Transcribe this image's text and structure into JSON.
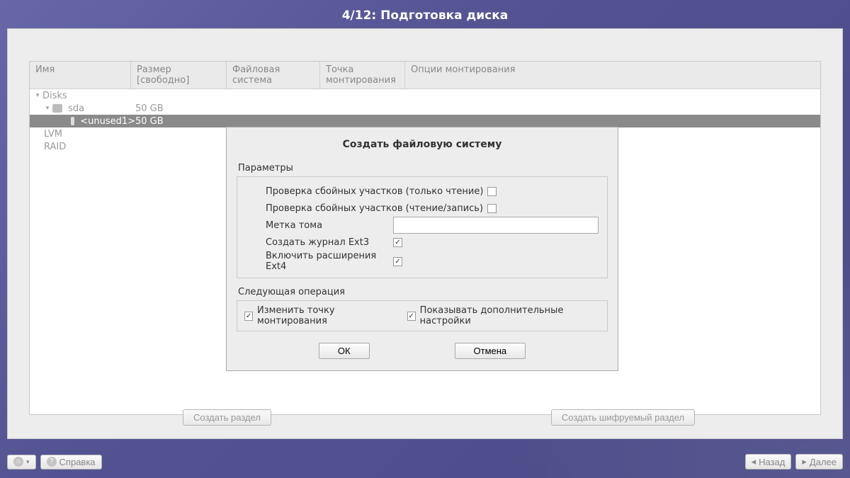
{
  "title": "4/12: Подготовка диска",
  "columns": {
    "name": "Имя",
    "size": "Размер [свободно]",
    "fs": "Файловая система",
    "mount": "Точка монтирования",
    "opts": "Опции монтирования"
  },
  "tree": {
    "disks_label": "Disks",
    "sda_label": "sda",
    "sda_size": "50 GB",
    "unused_label": "<unused1>",
    "unused_size": "50 GB",
    "lvm_label": "LVM",
    "raid_label": "RAID"
  },
  "bottom": {
    "create_partition": "Создать раздел",
    "create_encrypted": "Создать шифруемый раздел"
  },
  "footer": {
    "help": "Справка",
    "back": "Назад",
    "next": "Далее"
  },
  "dialog": {
    "title": "Создать файловую систему",
    "params_label": "Параметры",
    "check_ro": "Проверка сбойных участков (только чтение)",
    "check_rw": "Проверка сбойных участков (чтение/запись)",
    "volume_label": "Метка тома",
    "volume_value": "",
    "ext3_journal": "Создать журнал Ext3",
    "ext4_ext": "Включить расширения Ext4",
    "next_op_label": "Следующая операция",
    "change_mount": "Изменить точку монтирования",
    "show_advanced": "Показывать дополнительные настройки",
    "ok": "ОК",
    "cancel": "Отмена",
    "checks": {
      "ro": false,
      "rw": false,
      "ext3": true,
      "ext4": true,
      "change_mount": true,
      "show_advanced": true
    }
  }
}
